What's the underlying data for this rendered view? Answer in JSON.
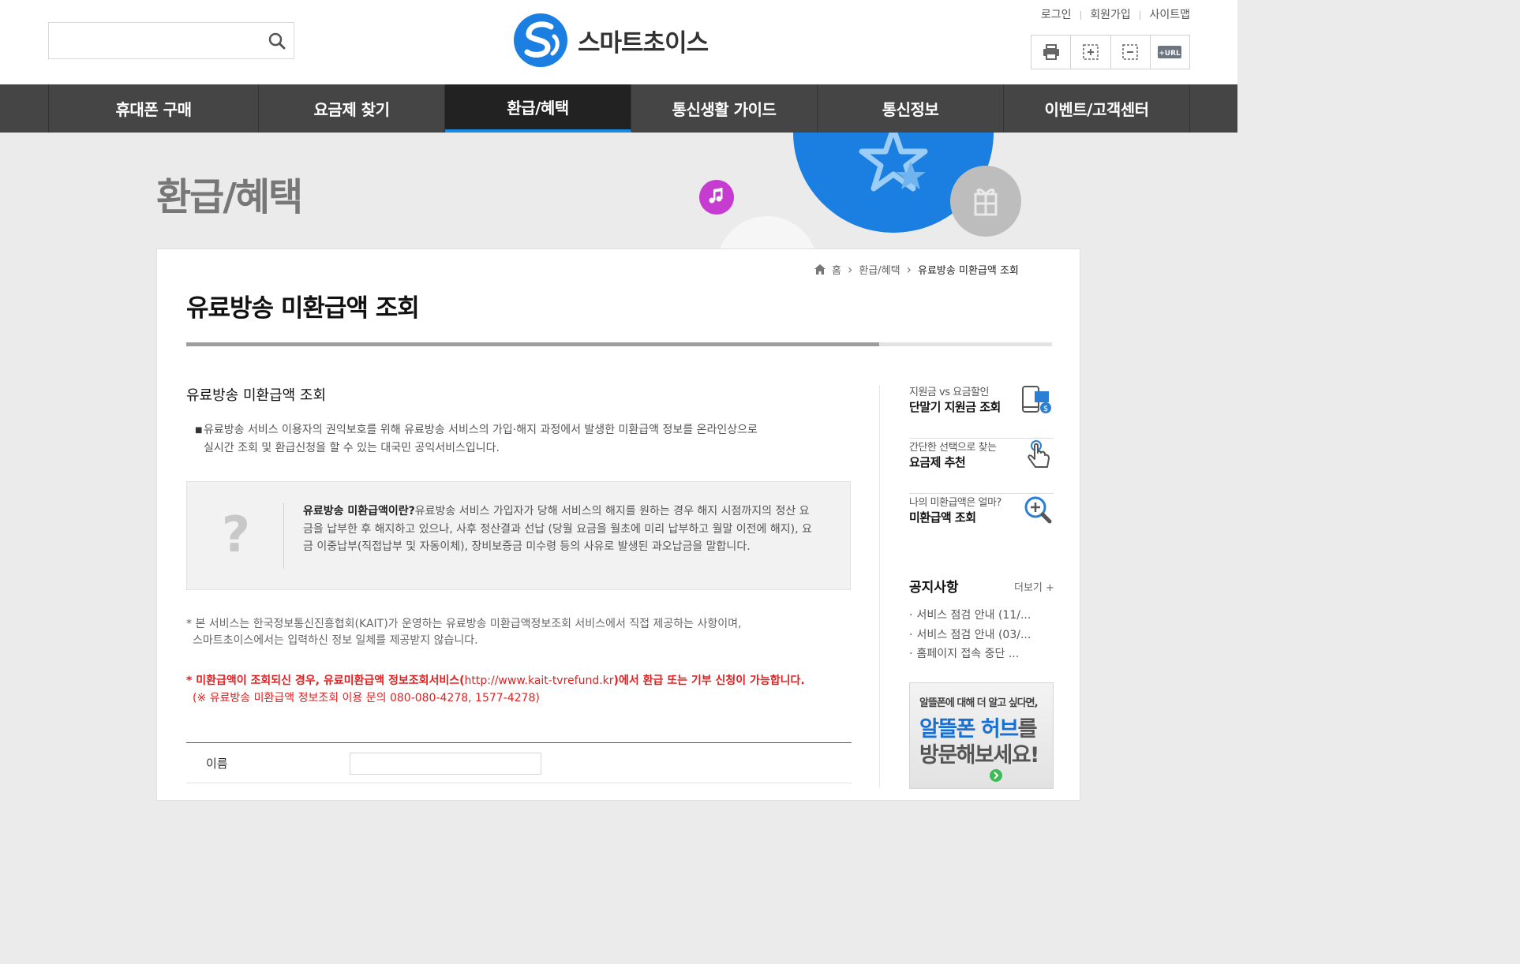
{
  "header": {
    "logo_text": "스마트초이스",
    "util_links": [
      "로그인",
      "회원가입",
      "사이트맵"
    ],
    "tool_url_label": "+URL",
    "search": {
      "value": "",
      "placeholder": ""
    }
  },
  "gnb": {
    "items": [
      {
        "label": "휴대폰 구매"
      },
      {
        "label": "요금제 찾기"
      },
      {
        "label": "환급/혜택"
      },
      {
        "label": "통신생활 가이드"
      },
      {
        "label": "통신정보"
      },
      {
        "label": "이벤트/고객센터"
      }
    ],
    "active_index": 2
  },
  "visual": {
    "heading": "환급/혜택"
  },
  "breadcrumb": {
    "home": "홈",
    "level1": "환급/혜택",
    "current": "유료방송 미환급액 조회"
  },
  "content": {
    "title": "유료방송 미환급액 조회",
    "title_progress": 0.8,
    "section_title": "유료방송 미환급액 조회",
    "intro_line1": "유료방송 서비스 이용자의 권익보호를 위해 유료방송 서비스의 가입·해지 과정에서 발생한 미환급액 정보를 온라인상으로",
    "intro_line2": "실시간 조회 및 환급신청을 할 수 있는 대국민 공익서비스입니다.",
    "info_q": "?",
    "info_strong": "유료방송 미환급액이란?",
    "info_text": "유료방송 서비스 가입자가 당해 서비스의 해지를 원하는 경우 해지 시점까지의 정산 요금을 납부한 후 해지하고 있으나, 사후 정산결과 선납 (당월 요금을 월초에 미리 납부하고 월말 이전에 해지), 요금 이중납부(직접납부 및 자동이체), 장비보증금 미수령 등의 사유로 발생된 과오납금을 말합니다.",
    "note1_line1": "* 본 서비스는 한국정보통신진흥협회(KAIT)가 운영하는 유료방송 미환급액정보조회 서비스에서 직접 제공하는 사항이며,",
    "note1_line2": "스마트초이스에서는 입력하신 정보 일체를 제공받지 않습니다.",
    "note2_star": "* ",
    "note2_a": "미환급액이 조회되신 경우, 유료미환급액 정보조회서비스(",
    "note2_url": "http://www.kait-tvrefund.kr",
    "note2_b": ")에서 환급 또는 기부 신청이 가능합니다.",
    "note3": "(※ 유료방송 미환급액 정보조회 이용 문의 080-080-4278, 1577-4278)",
    "form": {
      "name_label": "이름",
      "name_value": ""
    }
  },
  "side": {
    "quick": [
      {
        "sub": "지원금 vs 요금할인",
        "main": "단말기 지원금 조회",
        "icon": "phone-coin-icon"
      },
      {
        "sub": "간단한 선택으로 찾는",
        "main": "요금제 추천",
        "icon": "hand-pointer-icon"
      },
      {
        "sub": "나의 미환급액은 얼마?",
        "main": "미환급액 조회",
        "icon": "magnifier-plus-icon"
      }
    ],
    "notice_title": "공지사항",
    "notice_more": "더보기 +",
    "notices": [
      "서비스 점검 안내 (11/...",
      "서비스 점검 안내 (03/...",
      "홈페이지 접속 중단 ..."
    ],
    "banner": {
      "line1": "알뜰폰에 대해 더 알고 싶다면,",
      "line2a": "알뜰폰 허브",
      "line2b": "를",
      "line3": "방문해보세요!"
    }
  },
  "colors": {
    "accent": "#1a8ae5",
    "gnb_bg": "#454545",
    "warning": "#e02020",
    "logo_blue": "#1a7fe0"
  }
}
